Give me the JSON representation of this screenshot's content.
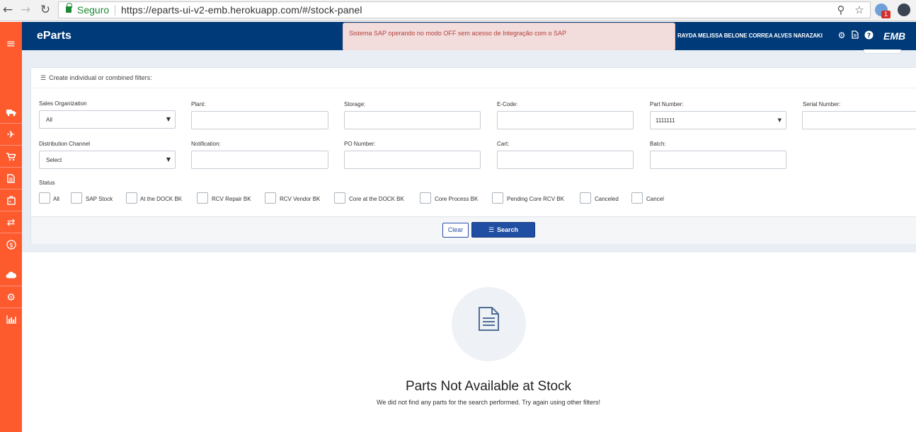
{
  "browser": {
    "secure_label": "Seguro",
    "url": "https://eparts-ui-v2-emb.herokuapp.com/#/stock-panel",
    "extension_badge": "1"
  },
  "header": {
    "brand": "eParts",
    "alert": "Sistema SAP operando no modo OFF sem acesso de Integração com o SAP",
    "user": "RAYDA MELISSA BELONE CORREA ALVES NARAZAKI",
    "logo": "EMB"
  },
  "sidebar": {
    "items": [
      {
        "icon": "menu-icon"
      },
      {
        "icon": "truck-icon"
      },
      {
        "icon": "airplane-icon"
      },
      {
        "icon": "cart-icon"
      },
      {
        "icon": "document-icon"
      },
      {
        "icon": "box-icon"
      },
      {
        "icon": "exchange-icon"
      },
      {
        "icon": "dollar-icon"
      },
      {
        "icon": "cloud-icon"
      },
      {
        "icon": "gears-icon"
      },
      {
        "icon": "bar-chart-icon"
      }
    ]
  },
  "filters": {
    "title": "Create individual or combined filters:",
    "sales_org": {
      "label": "Sales Organization",
      "value": "All"
    },
    "plant": {
      "label": "Plant:",
      "value": ""
    },
    "storage": {
      "label": "Storage:",
      "value": ""
    },
    "ecode": {
      "label": "E-Code:",
      "value": ""
    },
    "part_number": {
      "label": "Part Number:",
      "value": "1111111"
    },
    "serial_number": {
      "label": "Serial Number:",
      "value": ""
    },
    "distribution_channel": {
      "label": "Distribution Channel",
      "value": "Select"
    },
    "notification": {
      "label": "Notification:",
      "value": ""
    },
    "po_number": {
      "label": "PO Number:",
      "value": ""
    },
    "cart": {
      "label": "Cart:",
      "value": ""
    },
    "batch": {
      "label": "Batch:",
      "value": ""
    },
    "status_label": "Status",
    "statuses": [
      "All",
      "SAP Stock",
      "At the DOCK BK",
      "RCV Repair BK",
      "RCV Vendor BK",
      "Core at the DOCK BK",
      "Core Process BK",
      "Pending Core RCV BK",
      "Canceled",
      "Cancel"
    ],
    "clear_label": "Clear",
    "search_label": "Search"
  },
  "empty_state": {
    "title": "Parts Not Available at Stock",
    "subtitle": "We did not find any parts for the search performed. Try again using other filters!"
  },
  "colors": {
    "sidebar": "#fd5a2e",
    "header": "#003a78",
    "primary_button": "#1f4ea3",
    "alert_bg": "#f2dcdc",
    "alert_text": "#b4413c"
  }
}
